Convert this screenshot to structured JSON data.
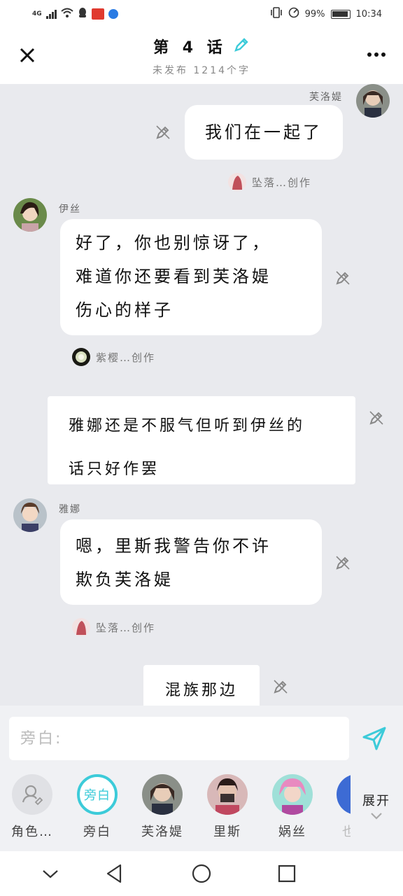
{
  "status_bar": {
    "network": "4G",
    "battery": "99%",
    "time": "10:34"
  },
  "header": {
    "title": "第 4 话",
    "subtitle": "未发布 1214个字"
  },
  "messages": [
    {
      "speaker": "芙洛媞",
      "text": "我们在一起了",
      "credit": "坠落…创作"
    },
    {
      "speaker": "伊丝",
      "text": "好了，你也别惊讶了，\n难道你还要看到芙洛媞\n伤心的样子",
      "credit": "紫樱…创作"
    },
    {
      "narration": "雅娜还是不服气但听到伊丝的\n话只好作罢"
    },
    {
      "speaker": "雅娜",
      "text": "嗯，里斯我警告你不许\n欺负芙洛媞",
      "credit": "坠落…创作"
    },
    {
      "narration": "混族那边"
    }
  ],
  "input": {
    "placeholder": "旁白:"
  },
  "roles": [
    {
      "label": "角色…"
    },
    {
      "label": "旁白",
      "pic_text": "旁白"
    },
    {
      "label": "芙洛媞"
    },
    {
      "label": "里斯"
    },
    {
      "label": "娲丝"
    },
    {
      "label": "也"
    }
  ],
  "expand_label": "展开",
  "colors": {
    "accent": "#3ccbd9",
    "background": "#e9eaee",
    "bubble": "#ffffff"
  }
}
